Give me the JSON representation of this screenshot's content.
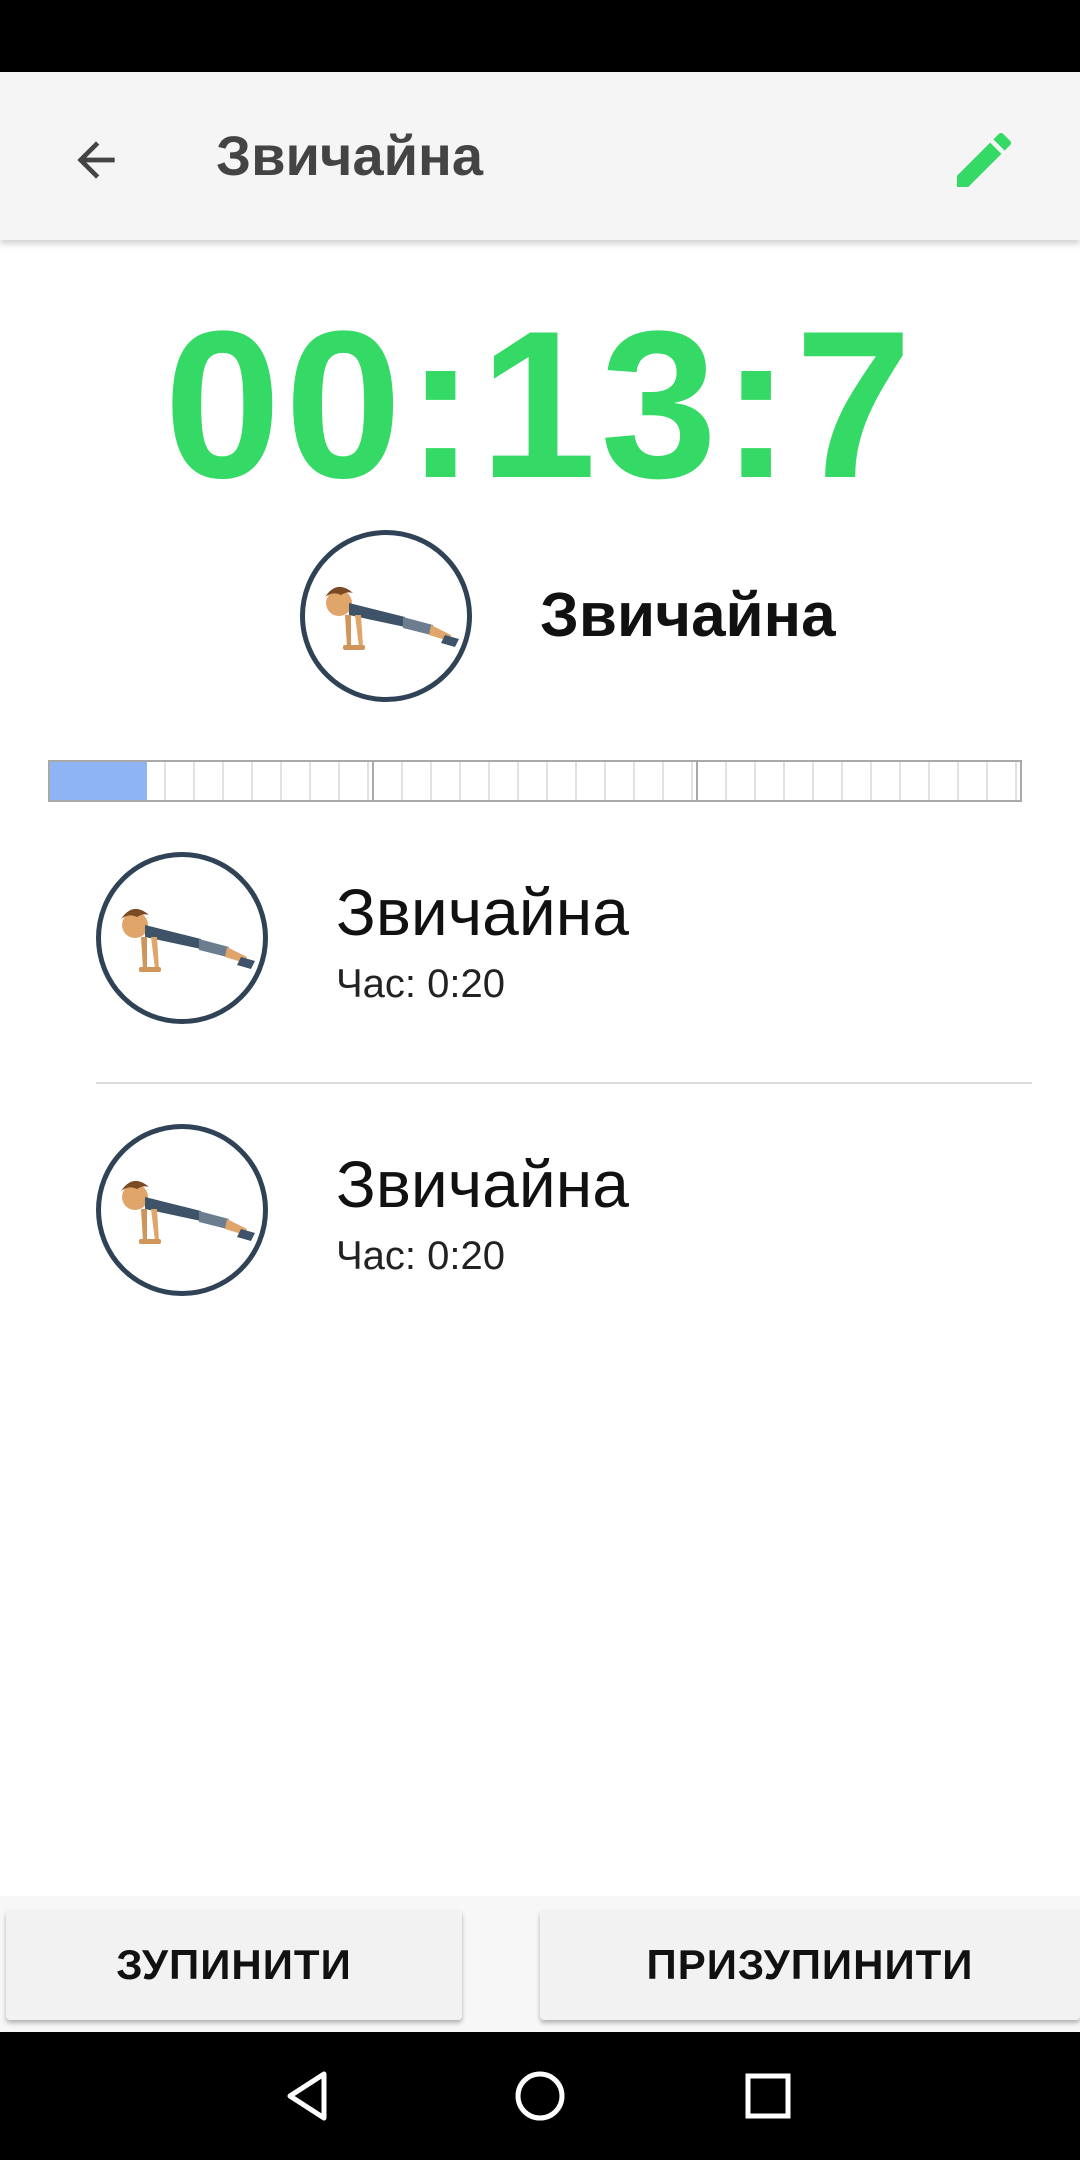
{
  "app_bar": {
    "title": "Звичайна",
    "back_icon": "arrow-left-icon",
    "edit_icon": "pencil-icon"
  },
  "timer": {
    "value": "00:13:7",
    "color": "#35d965"
  },
  "current_exercise": {
    "name": "Звичайна",
    "icon": "pushup-icon"
  },
  "progress": {
    "segments": 3,
    "fill_fraction": 0.3,
    "fill_color": "#8fb4f5"
  },
  "exercises": [
    {
      "name": "Звичайна",
      "time": "Час: 0:20",
      "icon": "pushup-icon"
    },
    {
      "name": "Звичайна",
      "time": "Час: 0:20",
      "icon": "pushup-icon"
    }
  ],
  "buttons": {
    "stop_label": "ЗУПИНИТИ",
    "pause_label": "ПРИЗУПИНИТИ"
  },
  "nav": {
    "back_icon": "nav-back-icon",
    "home_icon": "nav-home-icon",
    "recents_icon": "nav-recents-icon"
  }
}
